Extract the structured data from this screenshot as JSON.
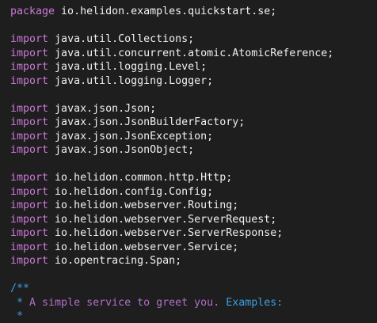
{
  "lines": [
    {
      "kind": "code",
      "keyword": "package",
      "rest": " io.helidon.examples.quickstart.se;"
    },
    {
      "kind": "blank"
    },
    {
      "kind": "code",
      "keyword": "import",
      "rest": " java.util.Collections;"
    },
    {
      "kind": "code",
      "keyword": "import",
      "rest": " java.util.concurrent.atomic.AtomicReference;"
    },
    {
      "kind": "code",
      "keyword": "import",
      "rest": " java.util.logging.Level;"
    },
    {
      "kind": "code",
      "keyword": "import",
      "rest": " java.util.logging.Logger;"
    },
    {
      "kind": "blank"
    },
    {
      "kind": "code",
      "keyword": "import",
      "rest": " javax.json.Json;"
    },
    {
      "kind": "code",
      "keyword": "import",
      "rest": " javax.json.JsonBuilderFactory;"
    },
    {
      "kind": "code",
      "keyword": "import",
      "rest": " javax.json.JsonException;"
    },
    {
      "kind": "code",
      "keyword": "import",
      "rest": " javax.json.JsonObject;"
    },
    {
      "kind": "blank"
    },
    {
      "kind": "code",
      "keyword": "import",
      "rest": " io.helidon.common.http.Http;"
    },
    {
      "kind": "code",
      "keyword": "import",
      "rest": " io.helidon.config.Config;"
    },
    {
      "kind": "code",
      "keyword": "import",
      "rest": " io.helidon.webserver.Routing;"
    },
    {
      "kind": "code",
      "keyword": "import",
      "rest": " io.helidon.webserver.ServerRequest;"
    },
    {
      "kind": "code",
      "keyword": "import",
      "rest": " io.helidon.webserver.ServerResponse;"
    },
    {
      "kind": "code",
      "keyword": "import",
      "rest": " io.helidon.webserver.Service;"
    },
    {
      "kind": "code",
      "keyword": "import",
      "rest": " io.opentracing.Span;"
    },
    {
      "kind": "blank"
    },
    {
      "kind": "comment",
      "text": "/**"
    },
    {
      "kind": "comment2",
      "star": " * ",
      "text": "A simple service to greet you. ",
      "tag": "Examples:"
    },
    {
      "kind": "comment",
      "text": " *"
    }
  ],
  "colors": {
    "background": "#1e1e1e",
    "keyword": "#cc78d8",
    "text": "#f0f0f0",
    "comment_marker": "#3ba0e6",
    "comment_text": "#b16fc6"
  }
}
